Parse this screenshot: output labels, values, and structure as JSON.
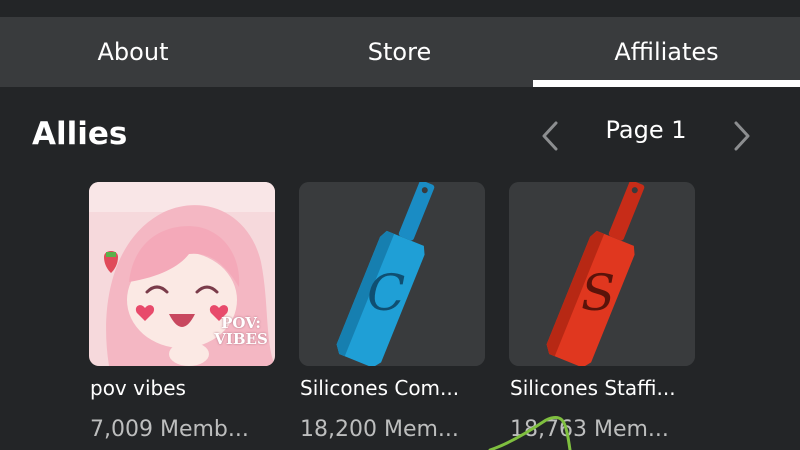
{
  "tabs": [
    {
      "label": "About"
    },
    {
      "label": "Store"
    },
    {
      "label": "Affiliates",
      "active": true
    }
  ],
  "section": {
    "title": "Allies",
    "page_label": "Page 1"
  },
  "groups": [
    {
      "name": "pov vibes",
      "members": "7,009 Memb...",
      "thumb_text": "POV: VIBES",
      "thumb_icon": "anime-avatar-icon"
    },
    {
      "name": "Silicones Com...",
      "members": "18,200 Mem...",
      "thumb_letter": "C",
      "thumb_icon": "blue-paddle-icon"
    },
    {
      "name": "Silicones Staffi...",
      "members": "18,763 Mem...",
      "thumb_letter": "S",
      "thumb_icon": "red-paddle-icon"
    }
  ],
  "colors": {
    "background": "#232527",
    "tab_bar": "#393b3d",
    "text": "#ffffff",
    "muted_text": "#bdbebe",
    "blue_paddle": "#1f9fd6",
    "red_paddle": "#e0371f",
    "scribble": "#7fbf3f"
  }
}
